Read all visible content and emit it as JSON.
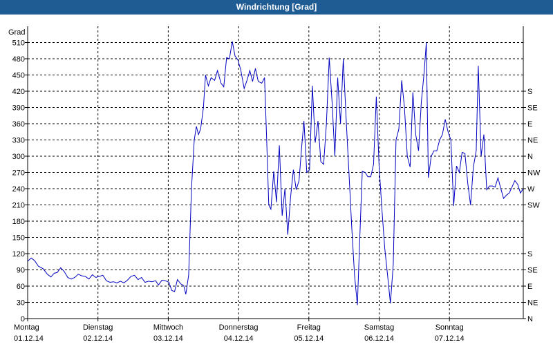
{
  "window": {
    "title": "Windrichtung [Grad]"
  },
  "colors": {
    "titlebar": "#1f5c94",
    "line": "#0000c0",
    "grid": "#000000",
    "background": "#ffffff"
  },
  "chart_data": {
    "type": "line",
    "title": "Windrichtung [Grad]",
    "ylabel": "Grad",
    "ylim": [
      0,
      540
    ],
    "yticks": [
      0,
      30,
      60,
      90,
      120,
      150,
      180,
      210,
      240,
      270,
      300,
      330,
      360,
      390,
      420,
      450,
      480,
      510
    ],
    "right_axis_labels": [
      "N",
      "NE",
      "E",
      "SE",
      "S",
      "SW",
      "W",
      "NW",
      "N",
      "NE",
      "E",
      "SE",
      "S"
    ],
    "right_axis_values": [
      0,
      30,
      60,
      90,
      120,
      210,
      240,
      270,
      300,
      330,
      360,
      390,
      420
    ],
    "xlim": [
      0,
      7.05
    ],
    "x_unit": "days since 01.12.14 00:00",
    "x_ticks": [
      {
        "x": 0,
        "day": "Montag",
        "date": "01.12.14"
      },
      {
        "x": 1,
        "day": "Dienstag",
        "date": "02.12.14"
      },
      {
        "x": 2,
        "day": "Mittwoch",
        "date": "03.12.14"
      },
      {
        "x": 3,
        "day": "Donnerstag",
        "date": "04.12.14"
      },
      {
        "x": 4,
        "day": "Freitag",
        "date": "05.12.14"
      },
      {
        "x": 5,
        "day": "Samstag",
        "date": "06.12.14"
      },
      {
        "x": 6,
        "day": "Sonntag",
        "date": "07.12.14"
      }
    ],
    "grid": true,
    "series": [
      {
        "name": "",
        "points": [
          [
            0.0,
            106
          ],
          [
            0.05,
            112
          ],
          [
            0.1,
            107
          ],
          [
            0.15,
            97
          ],
          [
            0.22,
            92
          ],
          [
            0.28,
            82
          ],
          [
            0.33,
            77
          ],
          [
            0.38,
            84
          ],
          [
            0.42,
            85
          ],
          [
            0.47,
            94
          ],
          [
            0.52,
            87
          ],
          [
            0.57,
            76
          ],
          [
            0.62,
            73
          ],
          [
            0.67,
            76
          ],
          [
            0.72,
            82
          ],
          [
            0.77,
            79
          ],
          [
            0.82,
            78
          ],
          [
            0.87,
            73
          ],
          [
            0.92,
            81
          ],
          [
            0.97,
            76
          ],
          [
            1.02,
            78
          ],
          [
            1.07,
            80
          ],
          [
            1.12,
            70
          ],
          [
            1.17,
            67
          ],
          [
            1.22,
            68
          ],
          [
            1.27,
            66
          ],
          [
            1.32,
            69
          ],
          [
            1.37,
            66
          ],
          [
            1.42,
            71
          ],
          [
            1.47,
            78
          ],
          [
            1.52,
            80
          ],
          [
            1.57,
            72
          ],
          [
            1.62,
            76
          ],
          [
            1.67,
            67
          ],
          [
            1.72,
            69
          ],
          [
            1.77,
            68
          ],
          [
            1.82,
            70
          ],
          [
            1.86,
            62
          ],
          [
            1.91,
            71
          ],
          [
            1.96,
            70
          ],
          [
            2.01,
            67
          ],
          [
            2.05,
            52
          ],
          [
            2.09,
            50
          ],
          [
            2.13,
            72
          ],
          [
            2.18,
            64
          ],
          [
            2.22,
            61
          ],
          [
            2.25,
            45
          ],
          [
            2.29,
            80
          ],
          [
            2.33,
            240
          ],
          [
            2.37,
            330
          ],
          [
            2.4,
            355
          ],
          [
            2.43,
            340
          ],
          [
            2.46,
            350
          ],
          [
            2.5,
            390
          ],
          [
            2.53,
            450
          ],
          [
            2.57,
            430
          ],
          [
            2.61,
            445
          ],
          [
            2.66,
            440
          ],
          [
            2.7,
            458
          ],
          [
            2.75,
            435
          ],
          [
            2.79,
            428
          ],
          [
            2.83,
            482
          ],
          [
            2.87,
            480
          ],
          [
            2.91,
            512
          ],
          [
            2.95,
            485
          ],
          [
            2.99,
            478
          ],
          [
            3.03,
            460
          ],
          [
            3.08,
            425
          ],
          [
            3.12,
            440
          ],
          [
            3.16,
            458
          ],
          [
            3.2,
            438
          ],
          [
            3.24,
            462
          ],
          [
            3.28,
            438
          ],
          [
            3.33,
            435
          ],
          [
            3.37,
            445
          ],
          [
            3.4,
            330
          ],
          [
            3.43,
            210
          ],
          [
            3.46,
            202
          ],
          [
            3.5,
            272
          ],
          [
            3.54,
            215
          ],
          [
            3.58,
            320
          ],
          [
            3.62,
            190
          ],
          [
            3.66,
            240
          ],
          [
            3.7,
            155
          ],
          [
            3.74,
            225
          ],
          [
            3.78,
            275
          ],
          [
            3.82,
            238
          ],
          [
            3.86,
            255
          ],
          [
            3.9,
            320
          ],
          [
            3.93,
            365
          ],
          [
            3.97,
            270
          ],
          [
            4.01,
            275
          ],
          [
            4.05,
            430
          ],
          [
            4.09,
            325
          ],
          [
            4.13,
            365
          ],
          [
            4.17,
            290
          ],
          [
            4.21,
            285
          ],
          [
            4.25,
            360
          ],
          [
            4.29,
            482
          ],
          [
            4.33,
            400
          ],
          [
            4.37,
            300
          ],
          [
            4.41,
            445
          ],
          [
            4.45,
            360
          ],
          [
            4.49,
            480
          ],
          [
            4.53,
            370
          ],
          [
            4.57,
            270
          ],
          [
            4.61,
            170
          ],
          [
            4.65,
            80
          ],
          [
            4.69,
            25
          ],
          [
            4.73,
            170
          ],
          [
            4.76,
            272
          ],
          [
            4.8,
            270
          ],
          [
            4.84,
            262
          ],
          [
            4.88,
            262
          ],
          [
            4.92,
            285
          ],
          [
            4.96,
            410
          ],
          [
            5.0,
            280
          ],
          [
            5.04,
            200
          ],
          [
            5.08,
            130
          ],
          [
            5.12,
            80
          ],
          [
            5.16,
            28
          ],
          [
            5.2,
            100
          ],
          [
            5.24,
            330
          ],
          [
            5.28,
            350
          ],
          [
            5.32,
            440
          ],
          [
            5.36,
            390
          ],
          [
            5.4,
            300
          ],
          [
            5.44,
            280
          ],
          [
            5.48,
            418
          ],
          [
            5.52,
            340
          ],
          [
            5.56,
            310
          ],
          [
            5.6,
            400
          ],
          [
            5.64,
            455
          ],
          [
            5.67,
            510
          ],
          [
            5.7,
            260
          ],
          [
            5.74,
            300
          ],
          [
            5.78,
            310
          ],
          [
            5.82,
            310
          ],
          [
            5.86,
            330
          ],
          [
            5.9,
            340
          ],
          [
            5.94,
            368
          ],
          [
            5.98,
            345
          ],
          [
            6.02,
            330
          ],
          [
            6.06,
            208
          ],
          [
            6.1,
            282
          ],
          [
            6.14,
            270
          ],
          [
            6.18,
            307
          ],
          [
            6.22,
            305
          ],
          [
            6.26,
            250
          ],
          [
            6.3,
            210
          ],
          [
            6.34,
            280
          ],
          [
            6.38,
            310
          ],
          [
            6.41,
            467
          ],
          [
            6.45,
            300
          ],
          [
            6.49,
            340
          ],
          [
            6.53,
            238
          ],
          [
            6.57,
            245
          ],
          [
            6.61,
            245
          ],
          [
            6.65,
            243
          ],
          [
            6.69,
            260
          ],
          [
            6.73,
            240
          ],
          [
            6.77,
            222
          ],
          [
            6.81,
            228
          ],
          [
            6.85,
            232
          ],
          [
            6.89,
            243
          ],
          [
            6.93,
            255
          ],
          [
            6.97,
            248
          ],
          [
            7.01,
            232
          ],
          [
            7.05,
            240
          ]
        ]
      }
    ]
  }
}
